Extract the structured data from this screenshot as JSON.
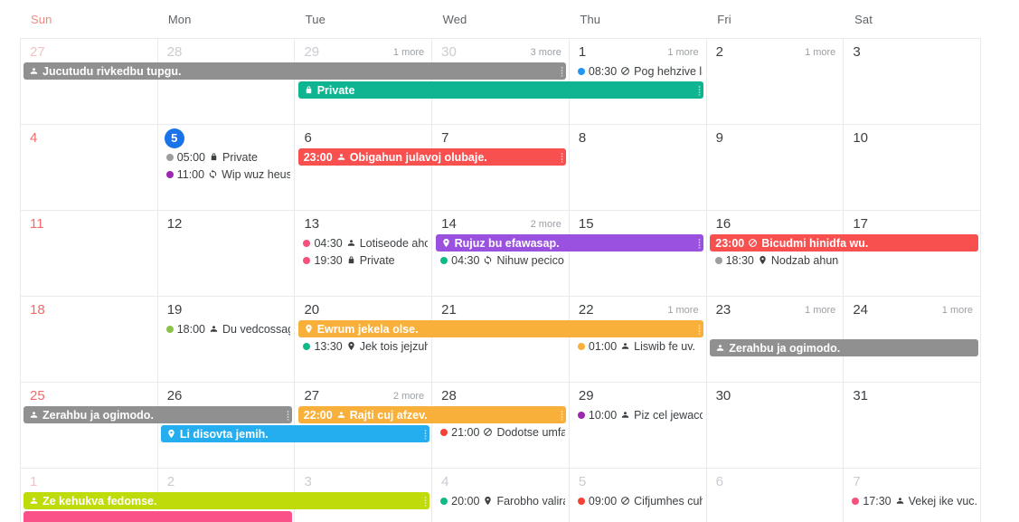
{
  "header": {
    "weekdays": [
      "Sun",
      "Mon",
      "Tue",
      "Wed",
      "Thu",
      "Fri",
      "Sat"
    ]
  },
  "labels": {
    "more_1": "1 more",
    "more_2": "2 more",
    "more_3": "3 more",
    "private": "Private"
  },
  "colors": {
    "grey": "#909090",
    "teal": "#0fb490",
    "red": "#f84f4f",
    "purple": "#9b51e0",
    "orange": "#f9b03a",
    "blue": "#24aef0",
    "lime": "#bfdb09",
    "pink": "#fa5189",
    "today_badge": "#1a73e8",
    "sunday_text": "#f06b6b",
    "grid_line": "#e8eaed",
    "dot_blue": "#2196f3",
    "dot_grey": "#9e9e9e",
    "dot_purple": "#9c27b0",
    "dot_pink": "#f4517c",
    "dot_teal": "#12b886",
    "dot_green": "#8bc34a",
    "dot_orange": "#f9b03a",
    "dot_red": "#f44336"
  },
  "weeks": [
    {
      "days": [
        {
          "num": "27",
          "muted": true,
          "sunday": true,
          "more": ""
        },
        {
          "num": "28",
          "muted": true,
          "sunday": false,
          "more": ""
        },
        {
          "num": "29",
          "muted": true,
          "sunday": false,
          "more": "1 more"
        },
        {
          "num": "30",
          "muted": true,
          "sunday": false,
          "more": "3 more"
        },
        {
          "num": "1",
          "muted": false,
          "sunday": false,
          "more": "1 more",
          "events": [
            {
              "kind": "timed",
              "dot": "dot_blue",
              "time": "08:30",
              "icon": "busy-icon",
              "title": "Pog hehzive la"
            }
          ]
        },
        {
          "num": "2",
          "muted": false,
          "sunday": false,
          "more": "1 more"
        },
        {
          "num": "3",
          "muted": false,
          "sunday": false,
          "more": ""
        }
      ],
      "bars": [
        {
          "color": "grey",
          "title": "Jucutudu rivkedbu tupgu.",
          "icon": "person-icon",
          "start": 0,
          "span": 4,
          "row": 0,
          "grip": true
        },
        {
          "color": "teal",
          "title": "Private",
          "icon": "lock-icon",
          "start": 2,
          "span": 3,
          "row": 1,
          "grip": true
        }
      ]
    },
    {
      "days": [
        {
          "num": "4",
          "muted": false,
          "sunday": true,
          "more": ""
        },
        {
          "num": "5",
          "muted": false,
          "sunday": false,
          "more": "",
          "today": true,
          "events": [
            {
              "kind": "timed",
              "dot": "dot_grey",
              "time": "05:00",
              "icon": "lock-icon",
              "title": "Private"
            },
            {
              "kind": "timed",
              "dot": "dot_purple",
              "time": "11:00",
              "icon": "repeat-icon",
              "title": "Wip wuz heus"
            }
          ]
        },
        {
          "num": "6",
          "muted": false,
          "sunday": false,
          "more": ""
        },
        {
          "num": "7",
          "muted": false,
          "sunday": false,
          "more": ""
        },
        {
          "num": "8",
          "muted": false,
          "sunday": false,
          "more": ""
        },
        {
          "num": "9",
          "muted": false,
          "sunday": false,
          "more": ""
        },
        {
          "num": "10",
          "muted": false,
          "sunday": false,
          "more": ""
        }
      ],
      "bars": [
        {
          "color": "red",
          "title": "Obigahun julavoj olubaje.",
          "time": "23:00",
          "icon": "person-icon",
          "start": 2,
          "span": 2,
          "row": 0,
          "grip": true
        }
      ]
    },
    {
      "days": [
        {
          "num": "11",
          "muted": false,
          "sunday": true,
          "more": ""
        },
        {
          "num": "12",
          "muted": false,
          "sunday": false,
          "more": ""
        },
        {
          "num": "13",
          "muted": false,
          "sunday": false,
          "more": "",
          "events": [
            {
              "kind": "timed",
              "dot": "dot_pink",
              "time": "04:30",
              "icon": "person-icon",
              "title": "Lotiseode aho"
            },
            {
              "kind": "timed",
              "dot": "dot_pink",
              "time": "19:30",
              "icon": "lock-icon",
              "title": "Private"
            }
          ]
        },
        {
          "num": "14",
          "muted": false,
          "sunday": false,
          "more": "2 more",
          "events": [
            {
              "kind": "spacer"
            },
            {
              "kind": "timed",
              "dot": "dot_teal",
              "time": "04:30",
              "icon": "repeat-icon",
              "title": "Nihuw pecico"
            }
          ]
        },
        {
          "num": "15",
          "muted": false,
          "sunday": false,
          "more": ""
        },
        {
          "num": "16",
          "muted": false,
          "sunday": false,
          "more": "",
          "events": [
            {
              "kind": "spacer"
            },
            {
              "kind": "timed",
              "dot": "dot_grey",
              "time": "18:30",
              "icon": "place-icon",
              "title": "Nodzab ahuna"
            }
          ]
        },
        {
          "num": "17",
          "muted": false,
          "sunday": false,
          "more": ""
        }
      ],
      "bars": [
        {
          "color": "purple",
          "title": "Rujuz bu efawasap.",
          "icon": "place-icon",
          "start": 3,
          "span": 2,
          "row": 0,
          "grip": true
        },
        {
          "color": "red",
          "title": "Bicudmi hinidfa wu.",
          "time": "23:00",
          "icon": "busy-icon",
          "start": 5,
          "span": 2,
          "row": 0,
          "grip": false
        }
      ]
    },
    {
      "days": [
        {
          "num": "18",
          "muted": false,
          "sunday": true,
          "more": ""
        },
        {
          "num": "19",
          "muted": false,
          "sunday": false,
          "more": "",
          "events": [
            {
              "kind": "timed",
              "dot": "dot_green",
              "time": "18:00",
              "icon": "person-icon",
              "title": "Du vedcossag"
            }
          ]
        },
        {
          "num": "20",
          "muted": false,
          "sunday": false,
          "more": "",
          "events": [
            {
              "kind": "spacer"
            },
            {
              "kind": "timed",
              "dot": "dot_teal",
              "time": "13:30",
              "icon": "place-icon",
              "title": "Jek tois jejzuhs"
            }
          ]
        },
        {
          "num": "21",
          "muted": false,
          "sunday": false,
          "more": ""
        },
        {
          "num": "22",
          "muted": false,
          "sunday": false,
          "more": "1 more",
          "events": [
            {
              "kind": "spacer"
            },
            {
              "kind": "timed",
              "dot": "dot_orange",
              "time": "01:00",
              "icon": "person-icon",
              "title": "Liswib fe uv."
            }
          ]
        },
        {
          "num": "23",
          "muted": false,
          "sunday": false,
          "more": "1 more"
        },
        {
          "num": "24",
          "muted": false,
          "sunday": false,
          "more": "1 more"
        }
      ],
      "bars": [
        {
          "color": "orange",
          "title": "Ewrum jekela olse.",
          "icon": "place-icon",
          "start": 2,
          "span": 3,
          "row": 0,
          "grip": true
        },
        {
          "color": "grey",
          "title": "Zerahbu ja ogimodo.",
          "icon": "person-icon",
          "start": 5,
          "span": 2,
          "row": 1,
          "grip": false
        }
      ]
    },
    {
      "days": [
        {
          "num": "25",
          "muted": false,
          "sunday": true,
          "more": ""
        },
        {
          "num": "26",
          "muted": false,
          "sunday": false,
          "more": ""
        },
        {
          "num": "27",
          "muted": false,
          "sunday": false,
          "more": "2 more"
        },
        {
          "num": "28",
          "muted": false,
          "sunday": false,
          "more": "",
          "events": [
            {
              "kind": "spacer"
            },
            {
              "kind": "timed",
              "dot": "dot_red",
              "time": "21:00",
              "icon": "busy-icon",
              "title": "Dodotse umfa"
            }
          ]
        },
        {
          "num": "29",
          "muted": false,
          "sunday": false,
          "more": "",
          "events": [
            {
              "kind": "timed",
              "dot": "dot_purple",
              "time": "10:00",
              "icon": "person-icon",
              "title": "Piz cel jewaco"
            }
          ]
        },
        {
          "num": "30",
          "muted": false,
          "sunday": false,
          "more": ""
        },
        {
          "num": "31",
          "muted": false,
          "sunday": false,
          "more": ""
        }
      ],
      "bars": [
        {
          "color": "grey",
          "title": "Zerahbu ja ogimodo.",
          "icon": "person-icon",
          "start": 0,
          "span": 2,
          "row": 0,
          "grip": true
        },
        {
          "color": "orange",
          "title": "Rajti cuj afzev.",
          "time": "22:00",
          "icon": "person-icon",
          "start": 2,
          "span": 2,
          "row": 0,
          "grip": true
        },
        {
          "color": "blue",
          "title": "Li disovta jemih.",
          "icon": "place-icon",
          "start": 1,
          "span": 2,
          "row": 1,
          "grip": true
        }
      ]
    },
    {
      "days": [
        {
          "num": "1",
          "muted": true,
          "sunday": true,
          "more": ""
        },
        {
          "num": "2",
          "muted": true,
          "sunday": false,
          "more": ""
        },
        {
          "num": "3",
          "muted": true,
          "sunday": false,
          "more": ""
        },
        {
          "num": "4",
          "muted": true,
          "sunday": false,
          "more": "",
          "events": [
            {
              "kind": "timed",
              "dot": "dot_teal",
              "time": "20:00",
              "icon": "place-icon",
              "title": "Farobho valira"
            }
          ]
        },
        {
          "num": "5",
          "muted": true,
          "sunday": false,
          "more": "",
          "events": [
            {
              "kind": "timed",
              "dot": "dot_red",
              "time": "09:00",
              "icon": "busy-icon",
              "title": "Cifjumhes cuh"
            }
          ]
        },
        {
          "num": "6",
          "muted": true,
          "sunday": false,
          "more": ""
        },
        {
          "num": "7",
          "muted": true,
          "sunday": false,
          "more": "",
          "events": [
            {
              "kind": "timed",
              "dot": "dot_pink",
              "time": "17:30",
              "icon": "person-icon",
              "title": "Vekej ike vuc."
            }
          ]
        }
      ],
      "bars": [
        {
          "color": "lime",
          "title": "Ze kehukva fedomse.",
          "icon": "person-icon",
          "start": 0,
          "span": 3,
          "row": 0,
          "grip": true
        },
        {
          "color": "pink",
          "title": "",
          "icon": "",
          "start": 0,
          "span": 2,
          "row": 1,
          "grip": false
        }
      ]
    }
  ]
}
